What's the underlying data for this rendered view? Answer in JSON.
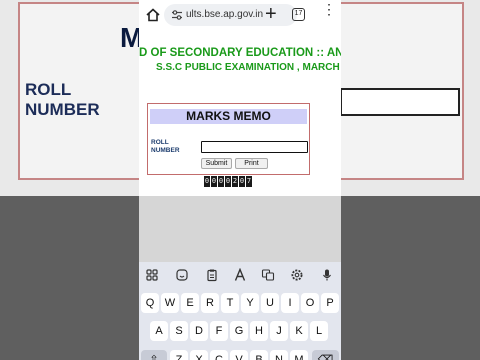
{
  "backdrop": {
    "title_fragment": "M",
    "roll_label_line1": "ROLL",
    "roll_label_line2": "NUMBER"
  },
  "browser": {
    "url": "ults.bse.ap.gov.in",
    "tab_count": "17",
    "new_tab_label": "+",
    "menu_label": "⋮"
  },
  "page": {
    "header_line1": "D OF SECONDARY EDUCATION :: ANDH",
    "header_line2": "S.S.C PUBLIC EXAMINATION , MARCH -",
    "memo_title": "MARKS MEMO",
    "roll_label_line1": "ROLL",
    "roll_label_line2": "NUMBER",
    "roll_input_value": "",
    "submit_label": "Submit",
    "print_label": "Print",
    "visitor_counter": [
      "0",
      "0",
      "0",
      "0",
      "2",
      "0",
      "7"
    ]
  },
  "keyboard": {
    "toolbar_icons": [
      "grid-icon",
      "sticker-icon",
      "clipboard-icon",
      "text-style-icon",
      "translate-icon",
      "settings-icon",
      "microphone-icon"
    ],
    "row1": [
      "Q",
      "W",
      "E",
      "R",
      "T",
      "Y",
      "U",
      "I",
      "O",
      "P"
    ],
    "row2": [
      "A",
      "S",
      "D",
      "F",
      "G",
      "H",
      "J",
      "K",
      "L"
    ],
    "row3": [
      "⇧",
      "Z",
      "X",
      "C",
      "V",
      "B",
      "N",
      "M",
      "⌫"
    ]
  },
  "colors": {
    "header_green": "#1a9a1a",
    "memo_title_bg": "#cfcff8",
    "memo_border": "#c26c6c",
    "roll_label_blue": "#1c3c6e"
  }
}
